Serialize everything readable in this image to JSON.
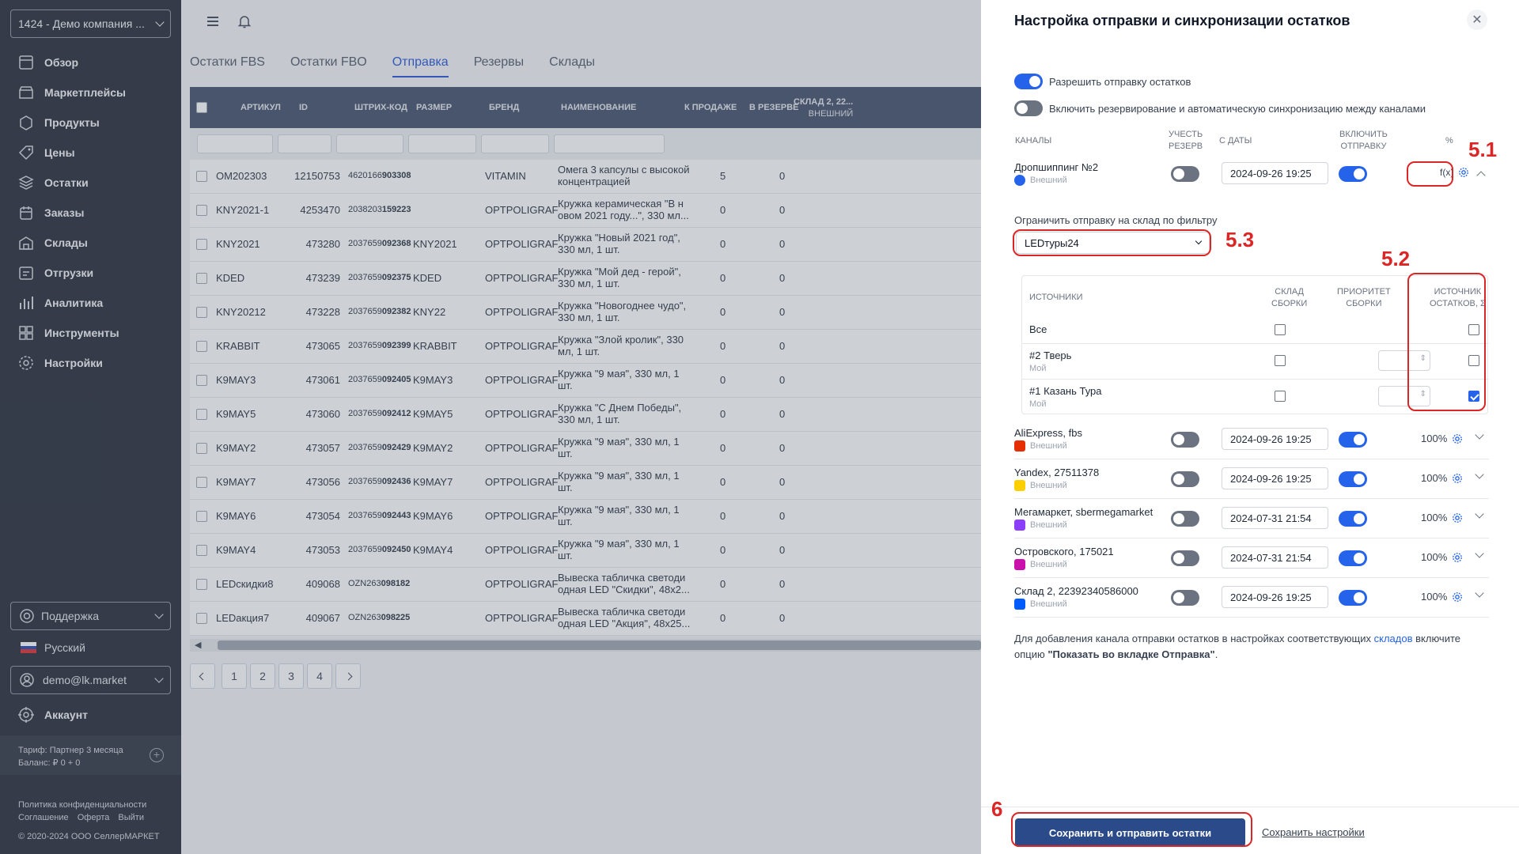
{
  "sidebar": {
    "company": "1424 - Демо компания ...",
    "nav": [
      {
        "label": "Обзор",
        "icon": "overview-icon"
      },
      {
        "label": "Маркетплейсы",
        "icon": "marketplaces-icon"
      },
      {
        "label": "Продукты",
        "icon": "products-icon"
      },
      {
        "label": "Цены",
        "icon": "prices-icon"
      },
      {
        "label": "Остатки",
        "icon": "stock-icon"
      },
      {
        "label": "Заказы",
        "icon": "orders-icon"
      },
      {
        "label": "Склады",
        "icon": "warehouses-icon"
      },
      {
        "label": "Отгрузки",
        "icon": "shipments-icon"
      },
      {
        "label": "Аналитика",
        "icon": "analytics-icon"
      },
      {
        "label": "Инструменты",
        "icon": "tools-icon"
      },
      {
        "label": "Настройки",
        "icon": "settings-icon"
      }
    ],
    "support": "Поддержка",
    "language": "Русский",
    "user": "demo@lk.market",
    "account": "Аккаунт",
    "tariff": "Тариф: Партнер 3 месяца",
    "balance": "Баланс: ₽ 0 + 0",
    "links": [
      "Политика конфиденциальности",
      "Соглашение",
      "Оферта",
      "Выйти"
    ],
    "copyright": "© 2020-2024 ООО СеллерМАРКЕТ"
  },
  "main": {
    "tabs": [
      "Остатки FBS",
      "Остатки FBO",
      "Отправка",
      "Резервы",
      "Склады"
    ],
    "active_tab": "Отправка",
    "columns": {
      "article": "АРТИКУЛ",
      "id": "ID",
      "barcode": "ШТРИХ-КОД",
      "size": "РАЗМЕР",
      "brand": "БРЕНД",
      "name": "НАИМЕНОВАНИЕ",
      "for_sale": "К ПРОДАЖЕ",
      "reserved": "В РЕЗЕРВЕ",
      "warehouse": "СКЛАД 2, 22...",
      "warehouse_sub": "ВНЕШНИЙ"
    },
    "rows": [
      {
        "article": "OM202303",
        "id": "12150753",
        "bc_a": "4620166",
        "bc_b": "903308",
        "size": "",
        "brand": "VITAMIN",
        "name": "Омега 3 капсулы с высокой концентрацией",
        "sale": "5",
        "res": "0"
      },
      {
        "article": "KNY2021-1",
        "id": "4253470",
        "bc_a": "2038203",
        "bc_b": "159223",
        "size": "",
        "brand": "OPTPOLIGRAF",
        "name": "Кружка керамическая \"В н овом 2021 году...\", 330 мл...",
        "sale": "0",
        "res": "0"
      },
      {
        "article": "KNY2021",
        "id": "473280",
        "bc_a": "2037659",
        "bc_b": "092368",
        "size": "KNY2021",
        "brand": "OPTPOLIGRAF",
        "name": "Кружка \"Новый 2021 год\", 330 мл, 1 шт.",
        "sale": "0",
        "res": "0"
      },
      {
        "article": "KDED",
        "id": "473239",
        "bc_a": "2037659",
        "bc_b": "092375",
        "size": "KDED",
        "brand": "OPTPOLIGRAF",
        "name": "Кружка \"Мой дед - герой\", 330 мл, 1 шт.",
        "sale": "0",
        "res": "0"
      },
      {
        "article": "KNY20212",
        "id": "473228",
        "bc_a": "2037659",
        "bc_b": "092382",
        "size": "KNY22",
        "brand": "OPTPOLIGRAF",
        "name": "Кружка \"Новогоднее чудо\", 330 мл, 1 шт.",
        "sale": "0",
        "res": "0"
      },
      {
        "article": "KRABBIT",
        "id": "473065",
        "bc_a": "2037659",
        "bc_b": "092399",
        "size": "KRABBIT",
        "brand": "OPTPOLIGRAF",
        "name": "Кружка \"Злой кролик\", 330 мл, 1 шт.",
        "sale": "0",
        "res": "0"
      },
      {
        "article": "K9MAY3",
        "id": "473061",
        "bc_a": "2037659",
        "bc_b": "092405",
        "size": "K9MAY3",
        "brand": "OPTPOLIGRAF",
        "name": "Кружка \"9 мая\", 330 мл, 1 шт.",
        "sale": "0",
        "res": "0"
      },
      {
        "article": "K9MAY5",
        "id": "473060",
        "bc_a": "2037659",
        "bc_b": "092412",
        "size": "K9MAY5",
        "brand": "OPTPOLIGRAF",
        "name": "Кружка \"С Днем Победы\", 330 мл, 1 шт.",
        "sale": "0",
        "res": "0"
      },
      {
        "article": "K9MAY2",
        "id": "473057",
        "bc_a": "2037659",
        "bc_b": "092429",
        "size": "K9MAY2",
        "brand": "OPTPOLIGRAF",
        "name": "Кружка \"9 мая\", 330 мл, 1 шт.",
        "sale": "0",
        "res": "0"
      },
      {
        "article": "K9MAY7",
        "id": "473056",
        "bc_a": "2037659",
        "bc_b": "092436",
        "size": "K9MAY7",
        "brand": "OPTPOLIGRAF",
        "name": "Кружка \"9 мая\", 330 мл, 1 шт.",
        "sale": "0",
        "res": "0"
      },
      {
        "article": "K9MAY6",
        "id": "473054",
        "bc_a": "2037659",
        "bc_b": "092443",
        "size": "K9MAY6",
        "brand": "OPTPOLIGRAF",
        "name": "Кружка \"9 мая\", 330 мл, 1 шт.",
        "sale": "0",
        "res": "0"
      },
      {
        "article": "K9MAY4",
        "id": "473053",
        "bc_a": "2037659",
        "bc_b": "092450",
        "size": "K9MAY4",
        "brand": "OPTPOLIGRAF",
        "name": "Кружка \"9 мая\", 330 мл, 1 шт.",
        "sale": "0",
        "res": "0"
      },
      {
        "article": "LEDскидки8",
        "id": "409068",
        "bc_a": "OZN263",
        "bc_b": "098182",
        "size": "",
        "brand": "OPTPOLIGRAF",
        "name": "Вывеска табличка светоди одная LED \"Скидки\", 48x2...",
        "sale": "0",
        "res": "0"
      },
      {
        "article": "LEDакция7",
        "id": "409067",
        "bc_a": "OZN263",
        "bc_b": "098225",
        "size": "",
        "brand": "OPTPOLIGRAF",
        "name": "Вывеска табличка светоди одная LED \"Акция\", 48x25...",
        "sale": "0",
        "res": "0"
      }
    ],
    "pages": [
      "1",
      "2",
      "3",
      "4"
    ]
  },
  "panel": {
    "title": "Настройка отправки и синхронизации остатков",
    "allow_send": "Разрешить отправку остатков",
    "enable_reserve": "Включить резервирование и автоматическую синхронизацию между каналами",
    "headers": {
      "channels": "КАНАЛЫ",
      "reserve_l1": "УЧЕСТЬ",
      "reserve_l2": "РЕЗЕРВ",
      "from_date": "С ДАТЫ",
      "send_l1": "ВКЛЮЧИТЬ",
      "send_l2": "ОТПРАВКУ",
      "pct": "%"
    },
    "first_channel": {
      "name": "Дропшиппинг №2",
      "type": "Внешний",
      "date": "2024-09-26 19:25",
      "fx": "f(x)"
    },
    "limit_label": "Ограничить отправку на склад по фильтру",
    "limit_value": "LEDтуры24",
    "sources_headers": {
      "sources": "ИСТОЧНИКИ",
      "assembly_l1": "СКЛАД",
      "assembly_l2": "СБОРКИ",
      "priority_l1": "ПРИОРИТЕТ",
      "priority_l2": "СБОРКИ",
      "stock_l1": "ИСТОЧНИК",
      "stock_l2": "ОСТАТКОВ, Σ"
    },
    "sources": [
      {
        "name": "Все",
        "sub": ""
      },
      {
        "name": "#2 Тверь",
        "sub": "Мой"
      },
      {
        "name": "#1 Казань Тура",
        "sub": "Мой"
      }
    ],
    "channels": [
      {
        "name": "AliExpress, fbs",
        "type": "Внешний",
        "date": "2024-09-26 19:25",
        "pct": "100%",
        "color": "#e62e04"
      },
      {
        "name": "Yandex, 27511378",
        "type": "Внешний",
        "date": "2024-09-26 19:25",
        "pct": "100%",
        "color": "#fcd000"
      },
      {
        "name": "Мегамаркет, sbermegamarket",
        "type": "Внешний",
        "date": "2024-07-31 21:54",
        "pct": "100%",
        "color": "#8b3ffd"
      },
      {
        "name": "Островского, 175021",
        "type": "Внешний",
        "date": "2024-07-31 21:54",
        "pct": "100%",
        "color": "#cb11ab"
      },
      {
        "name": "Склад 2, 22392340586000",
        "type": "Внешний",
        "date": "2024-09-26 19:25",
        "pct": "100%",
        "color": "#005bff"
      }
    ],
    "note_1": "Для добавления канала отправки остатков в настройках соответствующих ",
    "note_link": "складов",
    "note_2": " включите опцию ",
    "note_bold": "\"Показать во вкладке Отправка\"",
    "note_3": ".",
    "save_send": "Сохранить и отправить остатки",
    "save_settings": "Сохранить настройки"
  },
  "annotations": {
    "a51": "5.1",
    "a52": "5.2",
    "a53": "5.3",
    "a6": "6"
  },
  "colors": {
    "accent": "#2563eb",
    "annotation": "#dc2626",
    "sidebar": "#1f2430",
    "primary_button": "#2b4a8a"
  }
}
